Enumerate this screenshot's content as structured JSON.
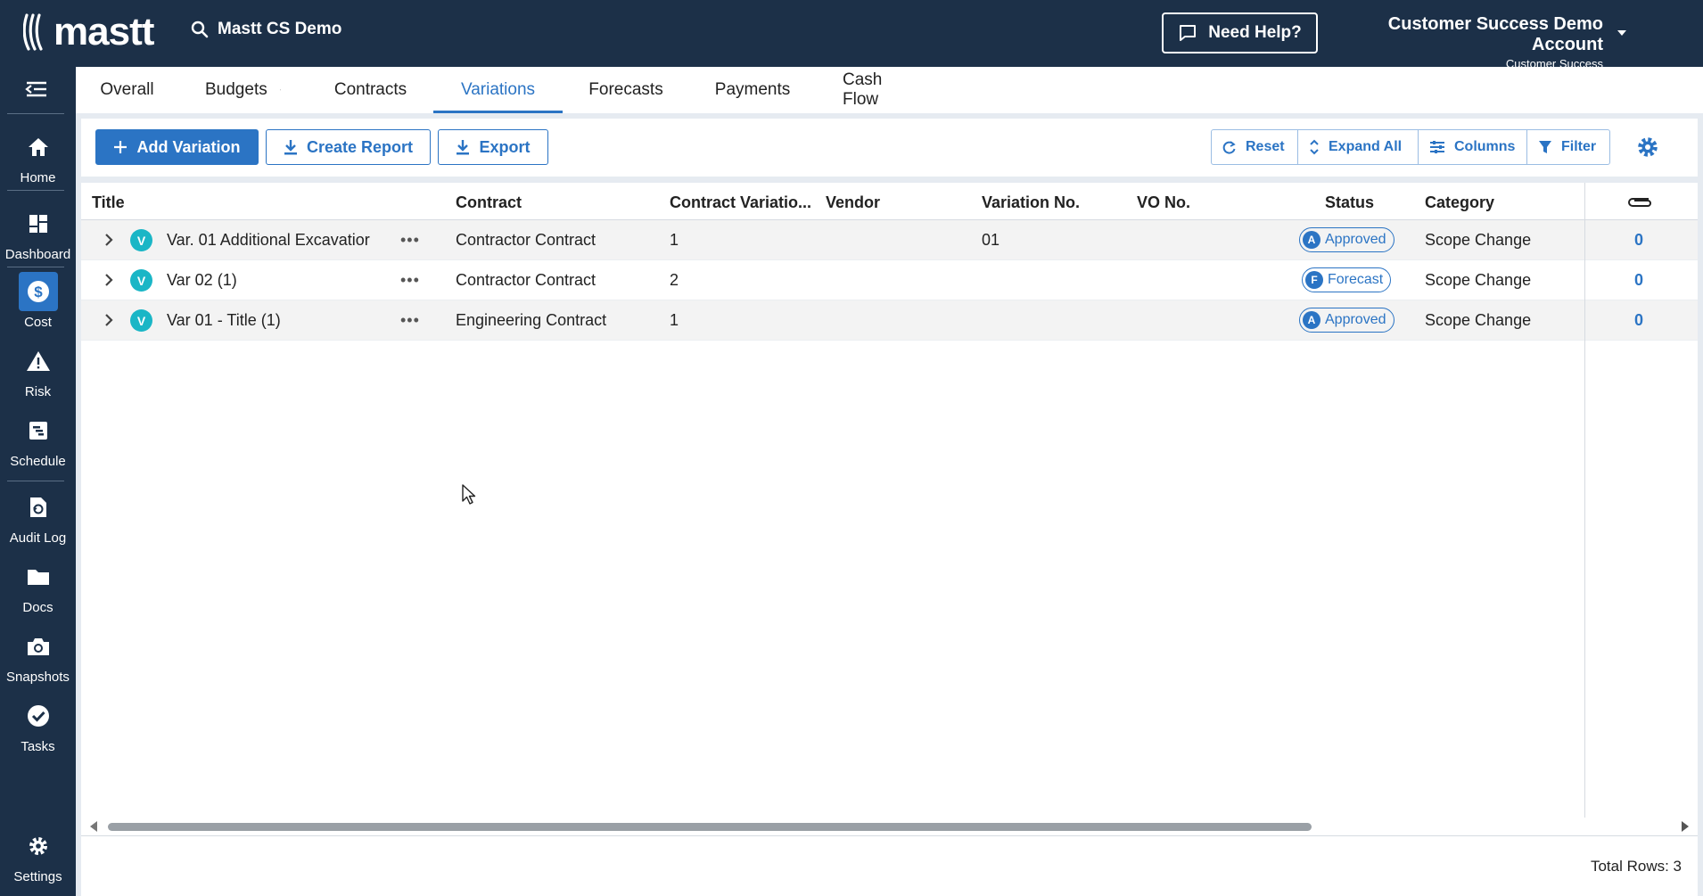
{
  "brand": {
    "logo_text": "mastt"
  },
  "header": {
    "project": "Mastt CS Demo",
    "help_label": "Need Help?",
    "account_name": "Customer Success Demo Account",
    "account_role": "Customer Success"
  },
  "sidebar": {
    "items": [
      {
        "label": "Home",
        "icon": "home-icon"
      },
      {
        "label": "Dashboard",
        "icon": "dashboard-icon"
      },
      {
        "label": "Cost",
        "icon": "dollar-icon",
        "active": true
      },
      {
        "label": "Risk",
        "icon": "warning-icon"
      },
      {
        "label": "Schedule",
        "icon": "schedule-icon"
      },
      {
        "label": "Audit Log",
        "icon": "audit-log-icon"
      },
      {
        "label": "Docs",
        "icon": "folder-icon"
      },
      {
        "label": "Snapshots",
        "icon": "camera-icon"
      },
      {
        "label": "Tasks",
        "icon": "check-circle-icon"
      }
    ],
    "settings_label": "Settings"
  },
  "tabs": [
    "Overall",
    "Budgets",
    "Contracts",
    "Variations",
    "Forecasts",
    "Payments",
    "Cash Flow"
  ],
  "active_tab": "Variations",
  "toolbar": {
    "add_label": "Add Variation",
    "report_label": "Create Report",
    "export_label": "Export",
    "reset_label": "Reset",
    "expand_label": "Expand All",
    "columns_label": "Columns",
    "filter_label": "Filter"
  },
  "grid": {
    "columns": [
      "Title",
      "Contract",
      "Contract Variatio...",
      "Vendor",
      "Variation No.",
      "VO No.",
      "Status",
      "Category"
    ],
    "rows": [
      {
        "badge": "V",
        "title": "Var. 01 Additional Excavatior",
        "contract": "Contractor Contract",
        "contract_variation": "1",
        "vendor": "",
        "variation_no": "01",
        "vo_no": "",
        "status_letter": "A",
        "status": "Approved",
        "category": "Scope Change",
        "attachments": "0"
      },
      {
        "badge": "V",
        "title": "Var 02  (1)",
        "contract": "Contractor Contract",
        "contract_variation": "2",
        "vendor": "",
        "variation_no": "",
        "vo_no": "",
        "status_letter": "F",
        "status": "Forecast",
        "category": "Scope Change",
        "attachments": "0"
      },
      {
        "badge": "V",
        "title": "Var 01 - Title  (1)",
        "contract": "Engineering Contract",
        "contract_variation": "1",
        "vendor": "",
        "variation_no": "",
        "vo_no": "",
        "status_letter": "A",
        "status": "Approved",
        "category": "Scope Change",
        "attachments": "0"
      }
    ],
    "total_rows": "Total Rows: 3"
  },
  "colors": {
    "navy": "#1c3048",
    "accent": "#2b74c4",
    "teal": "#1ab6c6"
  }
}
